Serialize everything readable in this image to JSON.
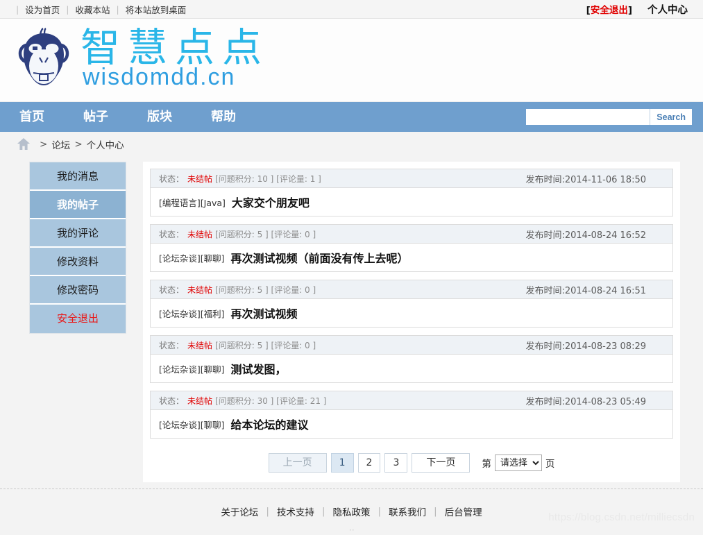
{
  "topbar": {
    "links": [
      {
        "label": "设为首页",
        "name": "set-homepage-link"
      },
      {
        "label": "收藏本站",
        "name": "bookmark-site-link"
      },
      {
        "label": "将本站放到桌面",
        "name": "add-to-desktop-link"
      }
    ],
    "logout_open": "[",
    "logout_label": "安全退出",
    "logout_close": "]",
    "user_center": "个人中心"
  },
  "logo": {
    "brand_cn": "智慧点点",
    "domain": "wisdomdd.cn",
    "mascot_color": "#2e3f7f",
    "brand_color": "#2ab6e8",
    "domain_color": "#2f9ee0"
  },
  "nav": {
    "accent": "#6f9fce",
    "items": [
      {
        "label": "首页",
        "name": "nav-item-home"
      },
      {
        "label": "帖子",
        "name": "nav-item-posts"
      },
      {
        "label": "版块",
        "name": "nav-item-sections"
      },
      {
        "label": "帮助",
        "name": "nav-item-help"
      }
    ],
    "search_value": "",
    "search_placeholder": "",
    "search_button": "Search"
  },
  "breadcrumb": {
    "home_icon": "home-icon",
    "sep1": ">",
    "item1": "论坛",
    "sep2": ">",
    "item2": "个人中心"
  },
  "sidebar": {
    "items": [
      {
        "label": "我的消息",
        "name": "sidebar-item-my-messages",
        "active": false,
        "danger": false
      },
      {
        "label": "我的帖子",
        "name": "sidebar-item-my-posts",
        "active": true,
        "danger": false
      },
      {
        "label": "我的评论",
        "name": "sidebar-item-my-comments",
        "active": false,
        "danger": false
      },
      {
        "label": "修改资料",
        "name": "sidebar-item-edit-profile",
        "active": false,
        "danger": false
      },
      {
        "label": "修改密码",
        "name": "sidebar-item-change-password",
        "active": false,
        "danger": false
      },
      {
        "label": "安全退出",
        "name": "sidebar-item-logout",
        "active": false,
        "danger": true
      }
    ],
    "active_bg": "#8cb2d2",
    "idle_bg": "#a9c6de",
    "danger_color": "#e81b1b"
  },
  "posts": {
    "status_label": "状态：",
    "time_prefix": "发布时间:",
    "items": [
      {
        "status": "未结帖",
        "meta": "[问题积分: 10 ] [评论量: 1 ]",
        "time": "发布时间:2014-11-06 18:50",
        "cats": "[编程语言][Java]",
        "title": "大家交个朋友吧"
      },
      {
        "status": "未结帖",
        "meta": "[问题积分: 5 ] [评论量: 0 ]",
        "time": "发布时间:2014-08-24 16:52",
        "cats": "[论坛杂谈][聊聊]",
        "title": "再次测试视频（前面没有传上去呢）"
      },
      {
        "status": "未结帖",
        "meta": "[问题积分: 5 ] [评论量: 0 ]",
        "time": "发布时间:2014-08-24 16:51",
        "cats": "[论坛杂谈][福利]",
        "title": "再次测试视频"
      },
      {
        "status": "未结帖",
        "meta": "[问题积分: 5 ] [评论量: 0 ]",
        "time": "发布时间:2014-08-23 08:29",
        "cats": "[论坛杂谈][聊聊]",
        "title": "测试发图，"
      },
      {
        "status": "未结帖",
        "meta": "[问题积分: 30 ] [评论量: 21 ]",
        "time": "发布时间:2014-08-23 05:49",
        "cats": "[论坛杂谈][聊聊]",
        "title": "给本论坛的建议"
      }
    ]
  },
  "pager": {
    "prev": "上一页",
    "pages": [
      "1",
      "2",
      "3"
    ],
    "current_page": "1",
    "next": "下一页",
    "jump_prefix": "第",
    "jump_selected": "请选择",
    "jump_options": [
      "请选择",
      "1",
      "2",
      "3"
    ],
    "jump_suffix": "页"
  },
  "footer": {
    "links": [
      {
        "label": "关于论坛",
        "name": "footer-link-about"
      },
      {
        "label": "技术支持",
        "name": "footer-link-support"
      },
      {
        "label": "隐私政策",
        "name": "footer-link-privacy"
      },
      {
        "label": "联系我们",
        "name": "footer-link-contact"
      },
      {
        "label": "后台管理",
        "name": "footer-link-admin"
      }
    ],
    "watermark": "https://blog.csdn.net/milliecsdn"
  }
}
